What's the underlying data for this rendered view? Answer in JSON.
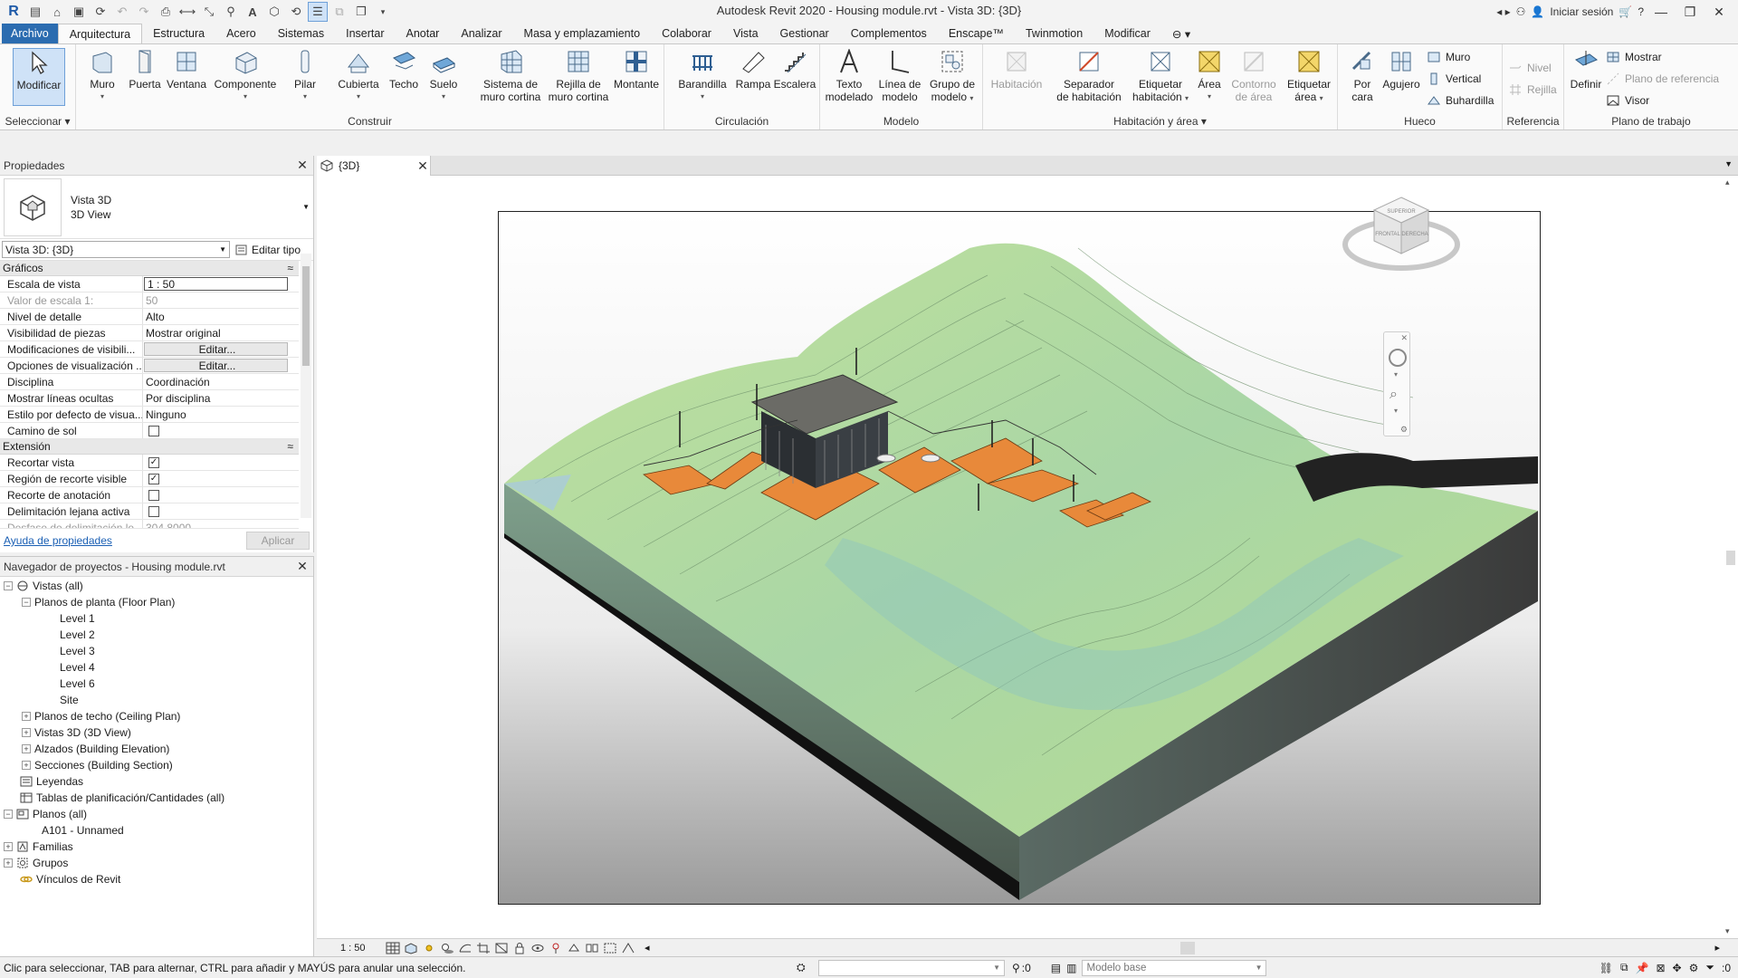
{
  "titlebar": {
    "title": "Autodesk Revit 2020 - Housing module.rvt - Vista 3D: {3D}",
    "signin": "Iniciar sesión"
  },
  "ribbon_tabs": [
    "Archivo",
    "Arquitectura",
    "Estructura",
    "Acero",
    "Sistemas",
    "Insertar",
    "Anotar",
    "Analizar",
    "Masa y emplazamiento",
    "Colaborar",
    "Vista",
    "Gestionar",
    "Complementos",
    "Enscape™",
    "Twinmotion",
    "Modificar"
  ],
  "ribbon": {
    "select": {
      "button": "Modificar",
      "group": "Seleccionar"
    },
    "build": {
      "group": "Construir",
      "buttons": [
        "Muro",
        "Puerta",
        "Ventana",
        "Componente",
        "Pilar",
        "Cubierta",
        "Techo",
        "Suelo",
        "Sistema de",
        "muro cortina",
        "Rejilla de",
        "muro cortina",
        "Montante"
      ]
    },
    "circulation": {
      "group": "Circulación",
      "buttons": [
        "Barandilla",
        "Rampa",
        "Escalera"
      ]
    },
    "model": {
      "group": "Modelo",
      "buttons": [
        "Texto",
        "modelado",
        "Línea de",
        "modelo",
        "Grupo de",
        "modelo"
      ]
    },
    "room": {
      "group": "Habitación y área",
      "buttons": [
        "Habitación",
        "Separador",
        "de habitación",
        "Etiquetar",
        "habitación",
        "Área",
        "Contorno",
        "de área",
        "Etiquetar",
        "área"
      ]
    },
    "opening": {
      "group": "Hueco",
      "buttons": [
        "Por",
        "cara",
        "Agujero"
      ],
      "small": [
        "Muro",
        "Vertical",
        "Buhardilla"
      ]
    },
    "datum": {
      "group": "Referencia",
      "small": [
        "Nivel",
        "Rejilla"
      ]
    },
    "workplane": {
      "group": "Plano de trabajo",
      "define": "Definir",
      "small": [
        "Mostrar",
        "Plano de referencia",
        "Visor"
      ]
    }
  },
  "properties": {
    "title": "Propiedades",
    "type_name": "Vista 3D",
    "type_sub": "3D View",
    "instance": "Vista 3D: {3D}",
    "edit_type": "Editar tipo",
    "sections": [
      {
        "name": "Gráficos",
        "rows": [
          {
            "name": "Escala de vista",
            "value": "1 : 50"
          },
          {
            "name": "Valor de escala    1:",
            "value": "50"
          },
          {
            "name": "Nivel de detalle",
            "value": "Alto"
          },
          {
            "name": "Visibilidad de piezas",
            "value": "Mostrar original"
          },
          {
            "name": "Modificaciones de visibili...",
            "value": "Editar..."
          },
          {
            "name": "Opciones de visualización ...",
            "value": "Editar..."
          },
          {
            "name": "Disciplina",
            "value": "Coordinación"
          },
          {
            "name": "Mostrar líneas ocultas",
            "value": "Por disciplina"
          },
          {
            "name": "Estilo por defecto de visua...",
            "value": "Ninguno"
          },
          {
            "name": "Camino de sol",
            "value": ""
          }
        ]
      },
      {
        "name": "Extensión",
        "rows": [
          {
            "name": "Recortar vista",
            "value": "✓"
          },
          {
            "name": "Región de recorte visible",
            "value": "✓"
          },
          {
            "name": "Recorte de anotación",
            "value": ""
          },
          {
            "name": "Delimitación lejana activa",
            "value": ""
          },
          {
            "name": "Desfase de delimitación le...",
            "value": "304 8000"
          }
        ]
      }
    ],
    "help_link": "Ayuda de propiedades",
    "apply": "Aplicar"
  },
  "browser": {
    "title": "Navegador de proyectos - Housing module.rvt",
    "items": [
      "Vistas (all)",
      "Planos de planta (Floor Plan)",
      "Level 1",
      "Level 2",
      "Level 3",
      "Level 4",
      "Level 6",
      "Site",
      "Planos de techo (Ceiling Plan)",
      "Vistas 3D (3D View)",
      "Alzados (Building Elevation)",
      "Secciones (Building Section)",
      "Leyendas",
      "Tablas de planificación/Cantidades (all)",
      "Planos (all)",
      "A101 - Unnamed",
      "Familias",
      "Grupos",
      "Vínculos de Revit"
    ]
  },
  "view": {
    "tab": "{3D}",
    "scale": "1 : 50",
    "viewcube_faces": [
      "SUPERIOR",
      "FRONTAL",
      "DERECHA"
    ]
  },
  "statusbar": {
    "hint": "Clic para seleccionar, TAB para alternar, CTRL para añadir y MAYÚS para anular una selección.",
    "count_a": ":0",
    "model": "Modelo base",
    "count_b": ":0"
  },
  "colors": {
    "accent": "#2b6cb0",
    "terrain": "#b5dc8a",
    "deck": "#e8893a",
    "road": "#222222"
  }
}
